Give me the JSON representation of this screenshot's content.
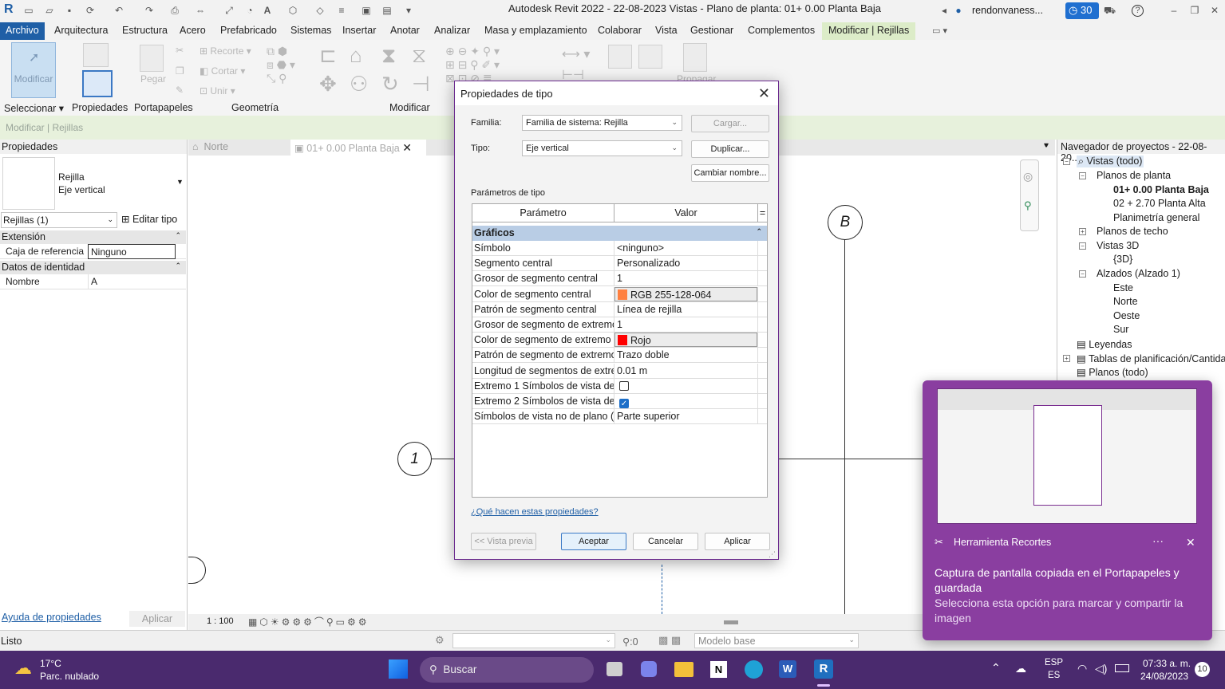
{
  "window": {
    "title": "Autodesk Revit 2022 - 22-08-2023 Vistas - Plano de planta: 01+ 0.00 Planta Baja",
    "user": "rendonvaness...",
    "clock_badge": "30"
  },
  "ribbon_tabs": [
    "Archivo",
    "Arquitectura",
    "Estructura",
    "Acero",
    "Prefabricado",
    "Sistemas",
    "Insertar",
    "Anotar",
    "Analizar",
    "Masa y emplazamiento",
    "Colaborar",
    "Vista",
    "Gestionar",
    "Complementos",
    "Modificar | Rejillas"
  ],
  "ribbon": {
    "modify_btn": "Modificar",
    "tools": [
      "Recorte",
      "Cortar",
      "Unir",
      "Pegar",
      "Propagar"
    ],
    "panels": [
      "Seleccionar",
      "Propiedades",
      "Portapapeles",
      "Geometría",
      "Modificar"
    ]
  },
  "context_bar": "Modificar | Rejillas",
  "properties": {
    "header": "Propiedades",
    "type_family": "Rejilla",
    "type_name": "Eje vertical",
    "filter": "Rejillas (1)",
    "edit_type": "Editar tipo",
    "cat1": "Extensión",
    "row1_label": "Caja de referencia",
    "row1_value": "Ninguno",
    "cat2": "Datos de identidad",
    "row2_label": "Nombre",
    "row2_value": "A",
    "help_link": "Ayuda de propiedades",
    "apply": "Aplicar"
  },
  "view_tabs": {
    "tab1": "Norte",
    "tab2": "01+ 0.00 Planta Baja"
  },
  "canvas": {
    "grid_b": "B",
    "grid_1": "1",
    "scale": "1 : 100"
  },
  "navigator": {
    "header": "Navegador de proyectos - 22-08-20...",
    "nodes": [
      "Vistas (todo)",
      "Planos de planta",
      "01+ 0.00 Planta Baja",
      "02 + 2.70 Planta Alta",
      "Planimetría general",
      "Planos de techo",
      "Vistas 3D",
      "{3D}",
      "Alzados (Alzado 1)",
      "Este",
      "Norte",
      "Oeste",
      "Sur",
      "Leyendas",
      "Tablas de planificación/Cantida",
      "Planos (todo)"
    ]
  },
  "dialog": {
    "title": "Propiedades de tipo",
    "family_label": "Familia:",
    "family_value": "Familia de sistema: Rejilla",
    "type_label": "Tipo:",
    "type_value": "Eje vertical",
    "load_btn": "Cargar...",
    "duplicate_btn": "Duplicar...",
    "rename_btn": "Cambiar nombre...",
    "params_label": "Parámetros de tipo",
    "col_param": "Parámetro",
    "col_value": "Valor",
    "col_eq": "=",
    "category": "Gráficos",
    "rows": [
      {
        "p": "Símbolo",
        "v": "<ninguno>"
      },
      {
        "p": "Segmento central",
        "v": "Personalizado"
      },
      {
        "p": "Grosor de segmento central",
        "v": "1"
      },
      {
        "p": "Color de segmento central",
        "v": "RGB 255-128-064",
        "color": "#ff8040"
      },
      {
        "p": "Patrón de segmento central",
        "v": "Línea de rejilla"
      },
      {
        "p": "Grosor de segmento de extremo",
        "v": "1"
      },
      {
        "p": "Color de segmento de extremo",
        "v": "Rojo",
        "color": "#ff0000"
      },
      {
        "p": "Patrón de segmento de extremo",
        "v": "Trazo doble"
      },
      {
        "p": "Longitud de segmentos de extre",
        "v": "0.01 m"
      },
      {
        "p": "Extremo 1 Símbolos de vista de",
        "v": "",
        "checked": false
      },
      {
        "p": "Extremo 2 Símbolos de vista de",
        "v": "",
        "checked": true
      },
      {
        "p": "Símbolos de vista no de plano (p",
        "v": "Parte superior"
      }
    ],
    "help_link": "¿Qué hacen estas propiedades?",
    "preview_btn": "<< Vista previa",
    "ok_btn": "Aceptar",
    "cancel_btn": "Cancelar",
    "apply_btn": "Aplicar"
  },
  "toast": {
    "app": "Herramienta Recortes",
    "title": "Captura de pantalla copiada en el Portapapeles y guardada",
    "body": "Selecciona esta opción para marcar y compartir la imagen"
  },
  "statusbar": {
    "status": "Listo",
    "selection_count": ":0",
    "model": "Modelo base"
  },
  "taskbar": {
    "temp": "17°C",
    "weather": "Parc. nublado",
    "search": "Buscar",
    "lang1": "ESP",
    "lang2": "ES",
    "time": "07:33 a. m.",
    "date": "24/08/2023",
    "notif": "10"
  }
}
